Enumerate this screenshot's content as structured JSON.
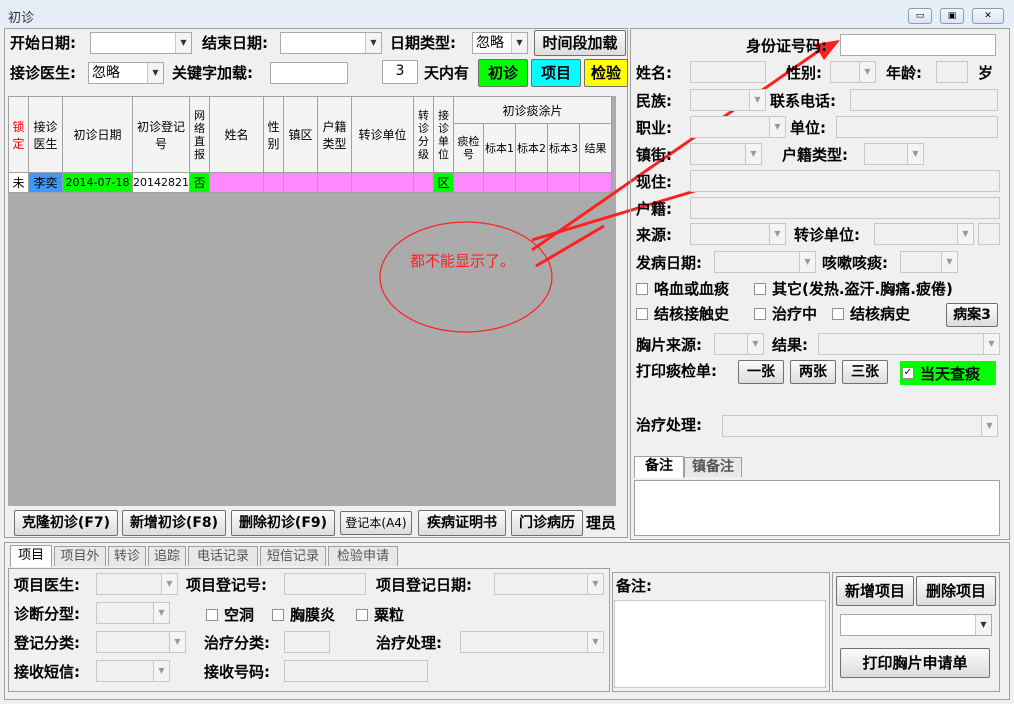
{
  "window": {
    "title": "初诊",
    "min": "▭",
    "max": "▣",
    "close": "✕"
  },
  "filters": {
    "start_date_label": "开始日期:",
    "start_date_value": "",
    "end_date_label": "结束日期:",
    "end_date_value": "",
    "date_type_label": "日期类型:",
    "date_type_value": "忽略",
    "time_load_button": "时间段加载",
    "doctor_label": "接诊医生:",
    "doctor_value": "忽略",
    "keyword_label": "关键字加载:",
    "keyword_value": "",
    "days_value": "3",
    "days_label": "天内有",
    "btn_first": "初诊",
    "btn_item": "项目",
    "btn_test": "检验"
  },
  "grid": {
    "headers": [
      "锁定",
      "接诊医生",
      "初诊日期",
      "初诊登记号",
      "网络直报",
      "姓名",
      "性别",
      "镇区",
      "户籍类型",
      "转诊单位",
      "转诊分级",
      "接诊单位"
    ],
    "smear_header": "初诊痰涂片",
    "smear_sub": [
      "痰检号",
      "标本1",
      "标本2",
      "标本3",
      "结果"
    ],
    "rows": [
      {
        "lock": "未",
        "doctor": "李奕",
        "date": "2014-07-18",
        "reg": "20142821",
        "report": "否",
        "unit": "区"
      }
    ]
  },
  "annotation": {
    "text": "都不能显示了。"
  },
  "bottom_buttons": [
    "克隆初诊(F7)",
    "新增初诊(F8)",
    "删除初诊(F9)",
    "登记本(A4)",
    "疾病证明书",
    "门诊病历"
  ],
  "bottom_trailing": "理员",
  "patient": {
    "id_label": "身份证号码:",
    "id_value": "",
    "name_label": "姓名:",
    "gender_label": "性别:",
    "age_label": "年龄:",
    "age_unit": "岁",
    "ethnic_label": "民族:",
    "phone_label": "联系电话:",
    "job_label": "职业:",
    "work_label": "单位:",
    "town_label": "镇街:",
    "hukou_label": "户籍类型:",
    "current_label": "现住:",
    "reg_label": "户籍:",
    "source_label": "来源:",
    "referral_label": "转诊单位:",
    "onset_label": "发病日期:",
    "cough_label": "咳嗽咳痰:",
    "hemoptysis": "咯血或血痰",
    "other": "其它(发热.盗汗.胸痛.疲倦)",
    "contact": "结核接触史",
    "treating": "治疗中",
    "history": "结核病史",
    "case_button": "病案3",
    "xray_label": "胸片来源:",
    "result_label": "结果:",
    "print_label": "打印痰检单:",
    "print_one": "一张",
    "print_two": "两张",
    "print_three": "三张",
    "same_day": "当天查痰",
    "same_day_checked": "✓",
    "treatment_label": "治疗处理:",
    "tab_note": "备注",
    "tab_town_note": "镇备注"
  },
  "lower_tabs": [
    "项目",
    "项目外",
    "转诊",
    "追踪",
    "电话记录",
    "短信记录",
    "检验申请"
  ],
  "project": {
    "doctor_label": "项目医生:",
    "reg_no_label": "项目登记号:",
    "reg_date_label": "项目登记日期:",
    "diag_label": "诊断分型:",
    "cavity": "空洞",
    "pleurisy": "胸膜炎",
    "miliary": "粟粒",
    "reg_class_label": "登记分类:",
    "treat_class_label": "治疗分类:",
    "treat_proc_label": "治疗处理:",
    "sms_label": "接收短信:",
    "sms_no_label": "接收号码:",
    "note_label": "备注:",
    "add_button": "新增项目",
    "delete_button": "删除项目",
    "print_button": "打印胸片申请单"
  },
  "colors": {
    "first": "#00ff00",
    "item": "#00ffff",
    "test": "#ffff00",
    "row": "#ff88ff",
    "doctor_cell": "#3a9aff",
    "arrow": "#ff2020"
  }
}
